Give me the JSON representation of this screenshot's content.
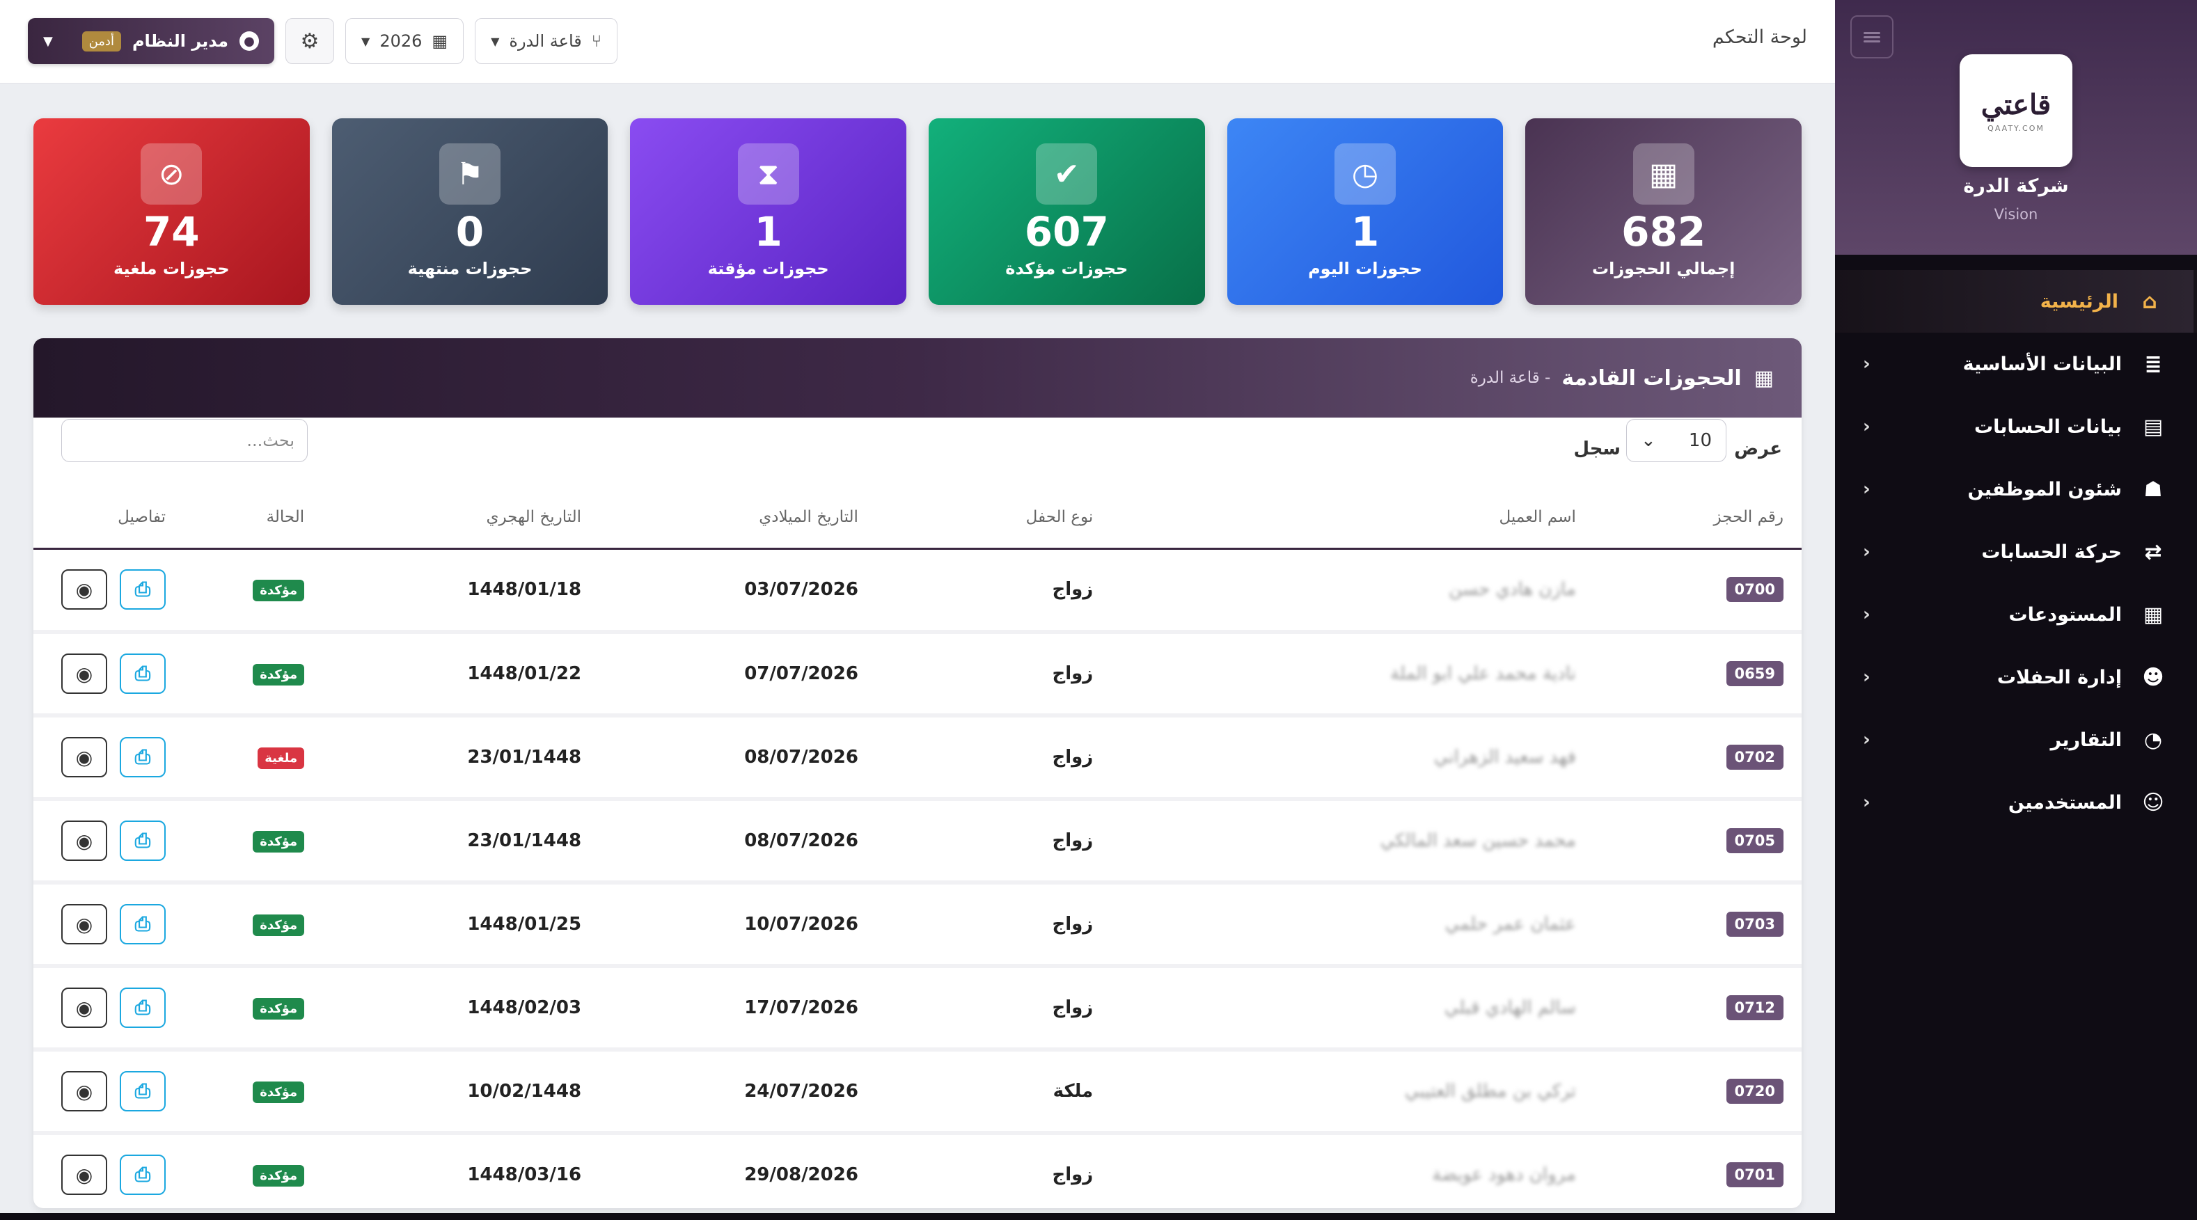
{
  "topbar": {
    "title": "لوحة التحكم",
    "user_name": "مدير النظام",
    "user_role": "أدمن",
    "year": "2026",
    "hall": "قاعة الدرة"
  },
  "sidebar": {
    "logo_text": "قاعتي",
    "logo_sub": "QAATY.COM",
    "company": "شركة الدرة",
    "company_sub": "Vision",
    "items": [
      {
        "label": "الرئيسية",
        "icon": "home-icon",
        "active": true
      },
      {
        "label": "البيانات الأساسية",
        "icon": "database-icon"
      },
      {
        "label": "بيانات الحسابات",
        "icon": "book-icon"
      },
      {
        "label": "شئون الموظفين",
        "icon": "users-icon"
      },
      {
        "label": "حركة الحسابات",
        "icon": "transfer-icon"
      },
      {
        "label": "المستودعات",
        "icon": "warehouse-icon"
      },
      {
        "label": "إدارة الحفلات",
        "icon": "masks-icon"
      },
      {
        "label": "التقارير",
        "icon": "pie-chart-icon"
      },
      {
        "label": "المستخدمين",
        "icon": "user-icon"
      }
    ]
  },
  "cards": [
    {
      "value": "682",
      "label": "إجمالي الحجوزات",
      "icon": "calendar-check-icon",
      "color": "#5b4264"
    },
    {
      "value": "1",
      "label": "حجوزات اليوم",
      "icon": "clock-icon",
      "color": "#2f6fe8"
    },
    {
      "value": "607",
      "label": "حجوزات مؤكدة",
      "icon": "check-circle-icon",
      "color": "#0f8a5f"
    },
    {
      "value": "1",
      "label": "حجوزات مؤقتة",
      "icon": "hourglass-icon",
      "color": "#6a35d6"
    },
    {
      "value": "0",
      "label": "حجوزات منتهية",
      "icon": "flag-checkered-icon",
      "color": "#3f4f63"
    },
    {
      "value": "74",
      "label": "حجوزات ملغية",
      "icon": "ban-icon",
      "color": "#c5242d"
    }
  ],
  "panel": {
    "title": "الحجوزات القادمة",
    "subtitle": "- قاعة الدرة",
    "show_label": "عرض",
    "page_size": "10",
    "records_label": "سجل",
    "search_placeholder": "بحث..."
  },
  "table": {
    "headers": [
      "رقم الحجز",
      "اسم العميل",
      "نوع الحفل",
      "التاريخ الميلادي",
      "التاريخ الهجري",
      "الحالة",
      "تفاصيل"
    ],
    "rows": [
      {
        "id": "0700",
        "name": "مازن هادي حسن",
        "type": "زواج",
        "greg": "03/07/2026",
        "hijri": "1448/01/18",
        "status": "مؤكدة",
        "status_kind": "ok"
      },
      {
        "id": "0659",
        "name": "نادية محمد علي ابو الملة",
        "type": "زواج",
        "greg": "07/07/2026",
        "hijri": "1448/01/22",
        "status": "مؤكدة",
        "status_kind": "ok"
      },
      {
        "id": "0702",
        "name": "فهد سعيد الزهراني",
        "type": "زواج",
        "greg": "08/07/2026",
        "hijri": "23/01/1448",
        "status": "ملغية",
        "status_kind": "cancel"
      },
      {
        "id": "0705",
        "name": "محمد حسين سعد المالكي",
        "type": "زواج",
        "greg": "08/07/2026",
        "hijri": "23/01/1448",
        "status": "مؤكدة",
        "status_kind": "ok"
      },
      {
        "id": "0703",
        "name": "عثمان عمر حلمي",
        "type": "زواج",
        "greg": "10/07/2026",
        "hijri": "1448/01/25",
        "status": "مؤكدة",
        "status_kind": "ok"
      },
      {
        "id": "0712",
        "name": "سالم الهادي قبلي",
        "type": "زواج",
        "greg": "17/07/2026",
        "hijri": "1448/02/03",
        "status": "مؤكدة",
        "status_kind": "ok"
      },
      {
        "id": "0720",
        "name": "تركي بن مطلق العتيبي",
        "type": "ملكة",
        "greg": "24/07/2026",
        "hijri": "10/02/1448",
        "status": "مؤكدة",
        "status_kind": "ok"
      },
      {
        "id": "0701",
        "name": "مروان دهود عويضة",
        "type": "زواج",
        "greg": "29/08/2026",
        "hijri": "1448/03/16",
        "status": "مؤكدة",
        "status_kind": "ok"
      }
    ]
  }
}
